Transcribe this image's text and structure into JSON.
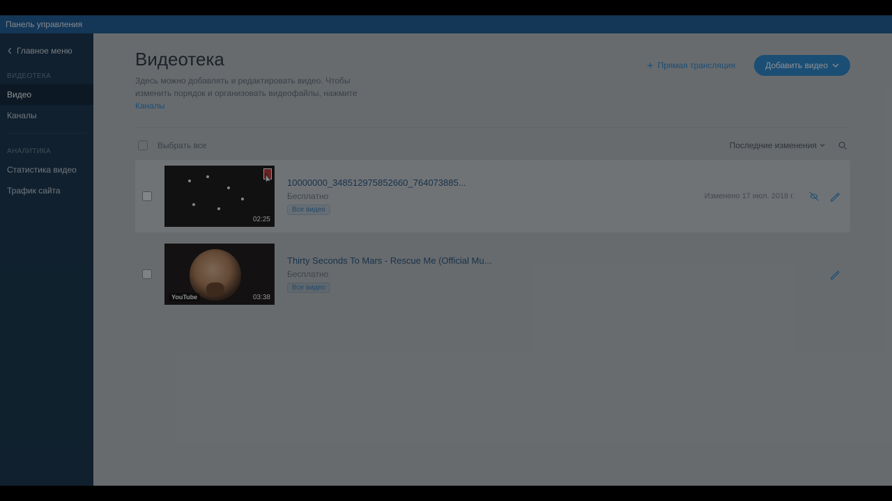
{
  "topbar": {
    "title": "Панель управления"
  },
  "sidebar": {
    "back_label": "Главное меню",
    "section_video": "ВИДЕОТЕКА",
    "items_video": [
      {
        "label": "Видео"
      },
      {
        "label": "Каналы"
      }
    ],
    "section_analytics": "АНАЛИТИКА",
    "items_analytics": [
      {
        "label": "Статистика видео"
      },
      {
        "label": "Трафик сайта"
      }
    ]
  },
  "header": {
    "title": "Видеотека",
    "subtitle_a": "Здесь можно добавлять и редактировать видео. Чтобы изменить порядок и организовать видеофайлы, нажмите ",
    "subtitle_link": "Каналы",
    "live_label": "Прямая трансляция",
    "add_label": "Добавить видео"
  },
  "toolbar": {
    "select_all": "Выбрать все",
    "sort_label": "Последние изменения"
  },
  "videos": [
    {
      "title": "10000000_348512975852660_764073885...",
      "price": "Бесплатно",
      "tag": "Все видео",
      "modified": "Изменено 17 июл. 2018 г.",
      "duration": "02:25"
    },
    {
      "title": "Thirty Seconds To Mars - Rescue Me (Official Mu...",
      "price": "Бесплатно",
      "tag": "Все видео",
      "duration": "03:38",
      "youtube": "YouTube"
    }
  ]
}
